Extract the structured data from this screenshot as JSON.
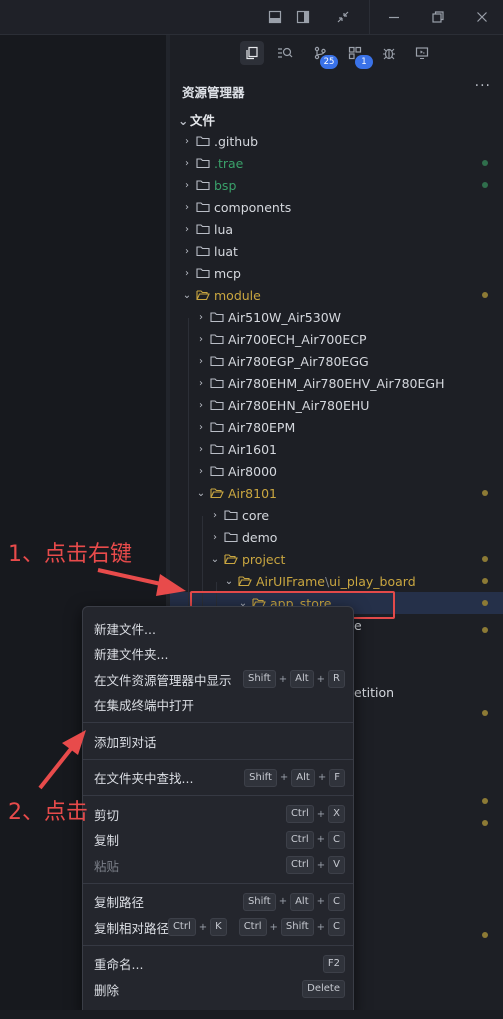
{
  "titlebar": {
    "icons": [
      "layout-panel-icon",
      "layout-sidebar-icon",
      "collapse-icon",
      "minimize-icon",
      "restore-icon",
      "close-icon"
    ]
  },
  "activity_bar": {
    "items": [
      {
        "icon": "files-icon",
        "active": true
      },
      {
        "icon": "search-icon"
      },
      {
        "icon": "source-control-icon",
        "badge": "25"
      },
      {
        "icon": "extensions-icon",
        "badge": "1"
      },
      {
        "icon": "debug-icon"
      },
      {
        "icon": "remote-icon"
      }
    ]
  },
  "explorer": {
    "title": "资源管理器",
    "more": "···",
    "section": "文件",
    "items": [
      {
        "label": ".github",
        "depth": 0,
        "open": false,
        "status": ""
      },
      {
        "label": ".trae",
        "depth": 0,
        "open": false,
        "status": "green"
      },
      {
        "label": "bsp",
        "depth": 0,
        "open": false,
        "status": "green"
      },
      {
        "label": "components",
        "depth": 0,
        "open": false,
        "status": ""
      },
      {
        "label": "lua",
        "depth": 0,
        "open": false,
        "status": ""
      },
      {
        "label": "luat",
        "depth": 0,
        "open": false,
        "status": ""
      },
      {
        "label": "mcp",
        "depth": 0,
        "open": false,
        "status": ""
      },
      {
        "label": "module",
        "depth": 0,
        "open": true,
        "status": "yellow"
      },
      {
        "label": "Air510W_Air530W",
        "depth": 1,
        "open": false,
        "status": ""
      },
      {
        "label": "Air700ECH_Air700ECP",
        "depth": 1,
        "open": false,
        "status": ""
      },
      {
        "label": "Air780EGP_Air780EGG",
        "depth": 1,
        "open": false,
        "status": ""
      },
      {
        "label": "Air780EHM_Air780EHV_Air780EGH",
        "depth": 1,
        "open": false,
        "status": ""
      },
      {
        "label": "Air780EHN_Air780EHU",
        "depth": 1,
        "open": false,
        "status": ""
      },
      {
        "label": "Air780EPM",
        "depth": 1,
        "open": false,
        "status": ""
      },
      {
        "label": "Air1601",
        "depth": 1,
        "open": false,
        "status": ""
      },
      {
        "label": "Air8000",
        "depth": 1,
        "open": false,
        "status": ""
      },
      {
        "label": "Air8101",
        "depth": 1,
        "open": true,
        "status": "yellow"
      },
      {
        "label": "core",
        "depth": 2,
        "open": false,
        "status": ""
      },
      {
        "label": "demo",
        "depth": 2,
        "open": false,
        "status": ""
      },
      {
        "label": "project",
        "depth": 2,
        "open": true,
        "status": "yellow"
      },
      {
        "label": "AirUIFrame",
        "label2": "ui_play_board",
        "depth": 3,
        "open": true,
        "status": "yellow"
      },
      {
        "label": "app_store",
        "depth": 4,
        "open": true,
        "status": "yellow",
        "selected": true
      }
    ],
    "behind_menu_text": [
      "e",
      "etition"
    ]
  },
  "context_menu": {
    "groups": [
      [
        {
          "label": "新建文件...",
          "keys": []
        },
        {
          "label": "新建文件夹...",
          "keys": []
        },
        {
          "label": "在文件资源管理器中显示",
          "keys": [
            [
              "Shift",
              "Alt",
              "R"
            ]
          ]
        },
        {
          "label": "在集成终端中打开",
          "keys": []
        }
      ],
      [
        {
          "label": "添加到对话",
          "keys": []
        }
      ],
      [
        {
          "label": "在文件夹中查找...",
          "keys": [
            [
              "Shift",
              "Alt",
              "F"
            ]
          ]
        }
      ],
      [
        {
          "label": "剪切",
          "keys": [
            [
              "Ctrl",
              "X"
            ]
          ]
        },
        {
          "label": "复制",
          "keys": [
            [
              "Ctrl",
              "C"
            ]
          ]
        },
        {
          "label": "粘贴",
          "keys": [
            [
              "Ctrl",
              "V"
            ]
          ],
          "disabled": true
        }
      ],
      [
        {
          "label": "复制路径",
          "keys": [
            [
              "Shift",
              "Alt",
              "C"
            ]
          ]
        },
        {
          "label": "复制相对路径",
          "keys": [
            [
              "Ctrl",
              "K"
            ],
            [
              "Ctrl",
              "Shift",
              "C"
            ]
          ]
        }
      ],
      [
        {
          "label": "重命名...",
          "keys": [
            [
              "F2"
            ]
          ]
        },
        {
          "label": "删除",
          "keys": [
            [
              "Delete"
            ]
          ]
        }
      ]
    ]
  },
  "annotations": {
    "step1": "1、点击右键",
    "step2": "2、点击"
  },
  "colors": {
    "accent_red": "#e84b4b",
    "modified_yellow": "#c9a640",
    "untracked_green": "#3aa16a",
    "badge_blue": "#3a72e8"
  }
}
